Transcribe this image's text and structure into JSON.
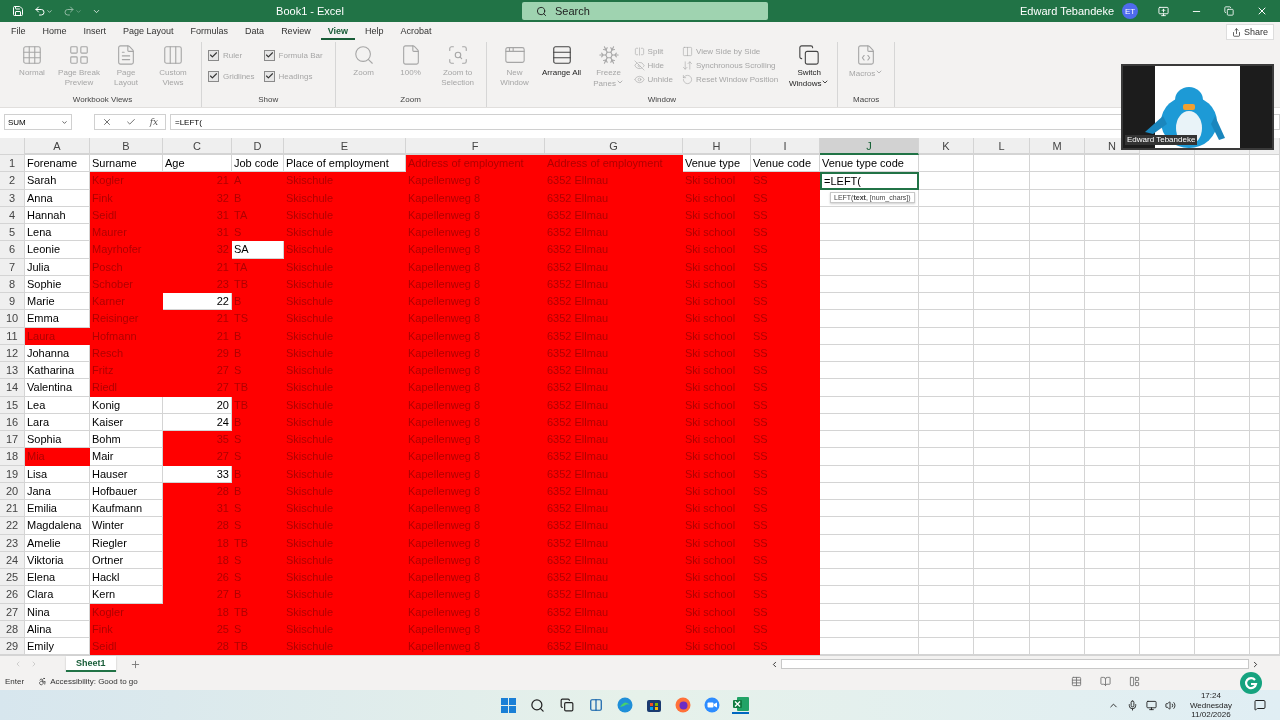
{
  "title_bar": {
    "title": "Book1  -  Excel",
    "search": {
      "placeholder": "Search"
    },
    "user": "Edward Tebandeke",
    "avatar": "ET"
  },
  "tabs": [
    {
      "label": "File",
      "selected": false
    },
    {
      "label": "Home",
      "selected": false
    },
    {
      "label": "Insert",
      "selected": false
    },
    {
      "label": "Page Layout",
      "selected": false
    },
    {
      "label": "Formulas",
      "selected": false
    },
    {
      "label": "Data",
      "selected": false
    },
    {
      "label": "Review",
      "selected": false
    },
    {
      "label": "View",
      "selected": true
    },
    {
      "label": "Help",
      "selected": false
    },
    {
      "label": "Acrobat",
      "selected": false
    }
  ],
  "share": "Share",
  "ribbon": {
    "groups": [
      {
        "label": "Workbook Views",
        "items": [
          {
            "kind": "large",
            "label": "Normal",
            "disabled": true
          },
          {
            "kind": "large",
            "label": "Page Break Preview",
            "disabled": true
          },
          {
            "kind": "large",
            "label": "Page Layout",
            "disabled": true
          },
          {
            "kind": "large",
            "label": "Custom Views",
            "disabled": true
          }
        ]
      },
      {
        "label": "Show",
        "items": [
          {
            "kind": "checkbox",
            "label": "Ruler",
            "checked": true,
            "disabled": true
          },
          {
            "kind": "checkbox",
            "label": "Gridlines",
            "checked": true,
            "disabled": true
          },
          {
            "kind": "checkbox",
            "label": "Formula Bar",
            "checked": true,
            "disabled": true
          },
          {
            "kind": "checkbox",
            "label": "Headings",
            "checked": true,
            "disabled": true
          }
        ]
      },
      {
        "label": "Zoom",
        "items": [
          {
            "kind": "large",
            "label": "Zoom",
            "disabled": true
          },
          {
            "kind": "large",
            "label": "100%",
            "disabled": true
          },
          {
            "kind": "large",
            "label": "Zoom to Selection",
            "disabled": true
          }
        ]
      },
      {
        "label": "Window",
        "items": [
          {
            "kind": "large",
            "label": "New Window",
            "disabled": true
          },
          {
            "kind": "large",
            "label": "Arrange All",
            "disabled": false
          },
          {
            "kind": "large",
            "label": "Freeze Panes",
            "disabled": true,
            "dropdown": true
          },
          {
            "kind": "small",
            "label": "Split",
            "disabled": true
          },
          {
            "kind": "small",
            "label": "Hide",
            "disabled": true
          },
          {
            "kind": "small",
            "label": "Unhide",
            "disabled": true
          },
          {
            "kind": "small",
            "label": "View Side by Side",
            "disabled": true
          },
          {
            "kind": "small",
            "label": "Synchronous Scrolling",
            "disabled": true
          },
          {
            "kind": "small",
            "label": "Reset Window Position",
            "disabled": true
          },
          {
            "kind": "large",
            "label": "Switch Windows",
            "disabled": false,
            "dropdown": true
          }
        ]
      },
      {
        "label": "Macros",
        "items": [
          {
            "kind": "large",
            "label": "Macros",
            "disabled": true,
            "dropdown": true
          }
        ]
      }
    ]
  },
  "formula_bar": {
    "name_box": "SUM",
    "function_button": "fx",
    "formula": "=LEFT("
  },
  "video_overlay": {
    "name": "Edward Tebandeke"
  },
  "sheet": {
    "columns": [
      {
        "label": "A",
        "selected": false
      },
      {
        "label": "B",
        "selected": false
      },
      {
        "label": "C",
        "selected": false
      },
      {
        "label": "D",
        "selected": false
      },
      {
        "label": "E",
        "selected": false
      },
      {
        "label": "F",
        "selected": false
      },
      {
        "label": "G",
        "selected": false
      },
      {
        "label": "H",
        "selected": false
      },
      {
        "label": "I",
        "selected": false
      },
      {
        "label": "J",
        "selected": true
      },
      {
        "label": "K",
        "selected": false
      },
      {
        "label": "L",
        "selected": false
      },
      {
        "label": "M",
        "selected": false
      },
      {
        "label": "N",
        "selected": false
      }
    ],
    "rows": [
      {
        "number": "1",
        "cells": [
          {
            "text": "Forename",
            "highlighted": false
          },
          {
            "text": "Surname",
            "highlighted": false
          },
          {
            "text": "Age",
            "highlighted": false
          },
          {
            "text": "Job code",
            "highlighted": false
          },
          {
            "text": "Place of employment",
            "highlighted": false
          },
          {
            "text": "Address of employment",
            "highlighted": true
          },
          {
            "text": "Address of employment",
            "highlighted": true
          },
          {
            "text": "Venue type",
            "highlighted": false
          },
          {
            "text": "Venue code",
            "highlighted": false
          },
          {
            "text": "Venue type code",
            "highlighted": false
          }
        ]
      },
      {
        "number": "2",
        "edit": {
          "text": "=LEFT(",
          "tooltip": "LEFT(**text**, [num_chars])"
        },
        "cells": [
          {
            "text": "Sarah",
            "highlighted": false
          },
          {
            "text": "Kogler",
            "highlighted": true
          },
          {
            "text": "21",
            "highlighted": true,
            "kind": "number"
          },
          {
            "text": "A",
            "highlighted": true
          },
          {
            "text": "Skischule",
            "highlighted": true
          },
          {
            "text": "Kapellenweg 8",
            "highlighted": true
          },
          {
            "text": "6352 Ellmau",
            "highlighted": true
          },
          {
            "text": "Ski school",
            "highlighted": true
          },
          {
            "text": "SS",
            "highlighted": true
          }
        ]
      },
      {
        "number": "3",
        "cells": [
          {
            "text": "Anna",
            "highlighted": false
          },
          {
            "text": "Fink",
            "highlighted": true
          },
          {
            "text": "32",
            "highlighted": true,
            "kind": "number"
          },
          {
            "text": "B",
            "highlighted": true
          },
          {
            "text": "Skischule",
            "highlighted": true
          },
          {
            "text": "Kapellenweg 8",
            "highlighted": true
          },
          {
            "text": "6352 Ellmau",
            "highlighted": true
          },
          {
            "text": "Ski school",
            "highlighted": true
          },
          {
            "text": "SS",
            "highlighted": true
          }
        ]
      },
      {
        "number": "4",
        "cells": [
          {
            "text": "Hannah",
            "highlighted": false
          },
          {
            "text": "Seidl",
            "highlighted": true
          },
          {
            "text": "31",
            "highlighted": true,
            "kind": "number"
          },
          {
            "text": "TA",
            "highlighted": true
          },
          {
            "text": "Skischule",
            "highlighted": true
          },
          {
            "text": "Kapellenweg 8",
            "highlighted": true
          },
          {
            "text": "6352 Ellmau",
            "highlighted": true
          },
          {
            "text": "Ski school",
            "highlighted": true
          },
          {
            "text": "SS",
            "highlighted": true
          }
        ]
      },
      {
        "number": "5",
        "cells": [
          {
            "text": "Lena",
            "highlighted": false
          },
          {
            "text": "Maurer",
            "highlighted": true
          },
          {
            "text": "31",
            "highlighted": true,
            "kind": "number"
          },
          {
            "text": "S",
            "highlighted": true
          },
          {
            "text": "Skischule",
            "highlighted": true
          },
          {
            "text": "Kapellenweg 8",
            "highlighted": true
          },
          {
            "text": "6352 Ellmau",
            "highlighted": true
          },
          {
            "text": "Ski school",
            "highlighted": true
          },
          {
            "text": "SS",
            "highlighted": true
          }
        ]
      },
      {
        "number": "6",
        "cells": [
          {
            "text": "Leonie",
            "highlighted": false
          },
          {
            "text": "Mayrhofer",
            "highlighted": true
          },
          {
            "text": "32",
            "highlighted": true,
            "kind": "number"
          },
          {
            "text": "SA",
            "highlighted": false
          },
          {
            "text": "Skischule",
            "highlighted": true
          },
          {
            "text": "Kapellenweg 8",
            "highlighted": true
          },
          {
            "text": "6352 Ellmau",
            "highlighted": true
          },
          {
            "text": "Ski school",
            "highlighted": true
          },
          {
            "text": "SS",
            "highlighted": true
          }
        ]
      },
      {
        "number": "7",
        "cells": [
          {
            "text": "Julia",
            "highlighted": false
          },
          {
            "text": "Posch",
            "highlighted": true
          },
          {
            "text": "21",
            "highlighted": true,
            "kind": "number"
          },
          {
            "text": "TA",
            "highlighted": true
          },
          {
            "text": "Skischule",
            "highlighted": true
          },
          {
            "text": "Kapellenweg 8",
            "highlighted": true
          },
          {
            "text": "6352 Ellmau",
            "highlighted": true
          },
          {
            "text": "Ski school",
            "highlighted": true
          },
          {
            "text": "SS",
            "highlighted": true
          }
        ]
      },
      {
        "number": "8",
        "cells": [
          {
            "text": "Sophie",
            "highlighted": false
          },
          {
            "text": "Schober",
            "highlighted": true
          },
          {
            "text": "23",
            "highlighted": true,
            "kind": "number"
          },
          {
            "text": "TB",
            "highlighted": true
          },
          {
            "text": "Skischule",
            "highlighted": true
          },
          {
            "text": "Kapellenweg 8",
            "highlighted": true
          },
          {
            "text": "6352 Ellmau",
            "highlighted": true
          },
          {
            "text": "Ski school",
            "highlighted": true
          },
          {
            "text": "SS",
            "highlighted": true
          }
        ]
      },
      {
        "number": "9",
        "cells": [
          {
            "text": "Marie",
            "highlighted": false
          },
          {
            "text": "Karner",
            "highlighted": true
          },
          {
            "text": "22",
            "highlighted": false,
            "kind": "number"
          },
          {
            "text": "B",
            "highlighted": true
          },
          {
            "text": "Skischule",
            "highlighted": true
          },
          {
            "text": "Kapellenweg 8",
            "highlighted": true
          },
          {
            "text": "6352 Ellmau",
            "highlighted": true
          },
          {
            "text": "Ski school",
            "highlighted": true
          },
          {
            "text": "SS",
            "highlighted": true
          }
        ]
      },
      {
        "number": "10",
        "cells": [
          {
            "text": "Emma",
            "highlighted": false
          },
          {
            "text": "Reisinger",
            "highlighted": true
          },
          {
            "text": "21",
            "highlighted": true,
            "kind": "number"
          },
          {
            "text": "TS",
            "highlighted": true
          },
          {
            "text": "Skischule",
            "highlighted": true
          },
          {
            "text": "Kapellenweg 8",
            "highlighted": true
          },
          {
            "text": "6352 Ellmau",
            "highlighted": true
          },
          {
            "text": "Ski school",
            "highlighted": true
          },
          {
            "text": "SS",
            "highlighted": true
          }
        ]
      },
      {
        "number": "11",
        "cells": [
          {
            "text": "Laura",
            "highlighted": true
          },
          {
            "text": "Hofmann",
            "highlighted": true
          },
          {
            "text": "21",
            "highlighted": true,
            "kind": "number"
          },
          {
            "text": "B",
            "highlighted": true
          },
          {
            "text": "Skischule",
            "highlighted": true
          },
          {
            "text": "Kapellenweg 8",
            "highlighted": true
          },
          {
            "text": "6352 Ellmau",
            "highlighted": true
          },
          {
            "text": "Ski school",
            "highlighted": true
          },
          {
            "text": "SS",
            "highlighted": true
          }
        ]
      },
      {
        "number": "12",
        "cells": [
          {
            "text": "Johanna",
            "highlighted": false
          },
          {
            "text": "Resch",
            "highlighted": true
          },
          {
            "text": "29",
            "highlighted": true,
            "kind": "number"
          },
          {
            "text": "B",
            "highlighted": true
          },
          {
            "text": "Skischule",
            "highlighted": true
          },
          {
            "text": "Kapellenweg 8",
            "highlighted": true
          },
          {
            "text": "6352 Ellmau",
            "highlighted": true
          },
          {
            "text": "Ski school",
            "highlighted": true
          },
          {
            "text": "SS",
            "highlighted": true
          }
        ]
      },
      {
        "number": "13",
        "cells": [
          {
            "text": "Katharina",
            "highlighted": false
          },
          {
            "text": "Fritz",
            "highlighted": true
          },
          {
            "text": "27",
            "highlighted": true,
            "kind": "number"
          },
          {
            "text": "S",
            "highlighted": true
          },
          {
            "text": "Skischule",
            "highlighted": true
          },
          {
            "text": "Kapellenweg 8",
            "highlighted": true
          },
          {
            "text": "6352 Ellmau",
            "highlighted": true
          },
          {
            "text": "Ski school",
            "highlighted": true
          },
          {
            "text": "SS",
            "highlighted": true
          }
        ]
      },
      {
        "number": "14",
        "cells": [
          {
            "text": "Valentina",
            "highlighted": false
          },
          {
            "text": "Riedl",
            "highlighted": true
          },
          {
            "text": "27",
            "highlighted": true,
            "kind": "number"
          },
          {
            "text": "TB",
            "highlighted": true
          },
          {
            "text": "Skischule",
            "highlighted": true
          },
          {
            "text": "Kapellenweg 8",
            "highlighted": true
          },
          {
            "text": "6352 Ellmau",
            "highlighted": true
          },
          {
            "text": "Ski school",
            "highlighted": true
          },
          {
            "text": "SS",
            "highlighted": true
          }
        ]
      },
      {
        "number": "15",
        "cells": [
          {
            "text": "Lea",
            "highlighted": false
          },
          {
            "text": "Konig",
            "highlighted": false
          },
          {
            "text": "20",
            "highlighted": false,
            "kind": "number"
          },
          {
            "text": "TB",
            "highlighted": true
          },
          {
            "text": "Skischule",
            "highlighted": true
          },
          {
            "text": "Kapellenweg 8",
            "highlighted": true
          },
          {
            "text": "6352 Ellmau",
            "highlighted": true
          },
          {
            "text": "Ski school",
            "highlighted": true
          },
          {
            "text": "SS",
            "highlighted": true
          }
        ]
      },
      {
        "number": "16",
        "cells": [
          {
            "text": "Lara",
            "highlighted": false
          },
          {
            "text": "Kaiser",
            "highlighted": false
          },
          {
            "text": "24",
            "highlighted": false,
            "kind": "number"
          },
          {
            "text": "B",
            "highlighted": true
          },
          {
            "text": "Skischule",
            "highlighted": true
          },
          {
            "text": "Kapellenweg 8",
            "highlighted": true
          },
          {
            "text": "6352 Ellmau",
            "highlighted": true
          },
          {
            "text": "Ski school",
            "highlighted": true
          },
          {
            "text": "SS",
            "highlighted": true
          }
        ]
      },
      {
        "number": "17",
        "cells": [
          {
            "text": "Sophia",
            "highlighted": false
          },
          {
            "text": "Bohm",
            "highlighted": false
          },
          {
            "text": "35",
            "highlighted": true,
            "kind": "number"
          },
          {
            "text": "S",
            "highlighted": true
          },
          {
            "text": "Skischule",
            "highlighted": true
          },
          {
            "text": "Kapellenweg 8",
            "highlighted": true
          },
          {
            "text": "6352 Ellmau",
            "highlighted": true
          },
          {
            "text": "Ski school",
            "highlighted": true
          },
          {
            "text": "SS",
            "highlighted": true
          }
        ]
      },
      {
        "number": "18",
        "cells": [
          {
            "text": "Mia",
            "highlighted": true
          },
          {
            "text": "Mair",
            "highlighted": false
          },
          {
            "text": "27",
            "highlighted": true,
            "kind": "number"
          },
          {
            "text": "S",
            "highlighted": true
          },
          {
            "text": "Skischule",
            "highlighted": true
          },
          {
            "text": "Kapellenweg 8",
            "highlighted": true
          },
          {
            "text": "6352 Ellmau",
            "highlighted": true
          },
          {
            "text": "Ski school",
            "highlighted": true
          },
          {
            "text": "SS",
            "highlighted": true
          }
        ]
      },
      {
        "number": "19",
        "cells": [
          {
            "text": "Lisa",
            "highlighted": false
          },
          {
            "text": "Hauser",
            "highlighted": false
          },
          {
            "text": "33",
            "highlighted": false,
            "kind": "number"
          },
          {
            "text": "B",
            "highlighted": true
          },
          {
            "text": "Skischule",
            "highlighted": true
          },
          {
            "text": "Kapellenweg 8",
            "highlighted": true
          },
          {
            "text": "6352 Ellmau",
            "highlighted": true
          },
          {
            "text": "Ski school",
            "highlighted": true
          },
          {
            "text": "SS",
            "highlighted": true
          }
        ]
      },
      {
        "number": "20",
        "cells": [
          {
            "text": "Jana",
            "highlighted": false
          },
          {
            "text": "Hofbauer",
            "highlighted": false
          },
          {
            "text": "28",
            "highlighted": true,
            "kind": "number"
          },
          {
            "text": "B",
            "highlighted": true
          },
          {
            "text": "Skischule",
            "highlighted": true
          },
          {
            "text": "Kapellenweg 8",
            "highlighted": true
          },
          {
            "text": "6352 Ellmau",
            "highlighted": true
          },
          {
            "text": "Ski school",
            "highlighted": true
          },
          {
            "text": "SS",
            "highlighted": true
          }
        ]
      },
      {
        "number": "21",
        "cells": [
          {
            "text": "Emilia",
            "highlighted": false
          },
          {
            "text": "Kaufmann",
            "highlighted": false
          },
          {
            "text": "31",
            "highlighted": true,
            "kind": "number"
          },
          {
            "text": "S",
            "highlighted": true
          },
          {
            "text": "Skischule",
            "highlighted": true
          },
          {
            "text": "Kapellenweg 8",
            "highlighted": true
          },
          {
            "text": "6352 Ellmau",
            "highlighted": true
          },
          {
            "text": "Ski school",
            "highlighted": true
          },
          {
            "text": "SS",
            "highlighted": true
          }
        ]
      },
      {
        "number": "22",
        "cells": [
          {
            "text": "Magdalena",
            "highlighted": false
          },
          {
            "text": "Winter",
            "highlighted": false
          },
          {
            "text": "28",
            "highlighted": true,
            "kind": "number"
          },
          {
            "text": "S",
            "highlighted": true
          },
          {
            "text": "Skischule",
            "highlighted": true
          },
          {
            "text": "Kapellenweg 8",
            "highlighted": true
          },
          {
            "text": "6352 Ellmau",
            "highlighted": true
          },
          {
            "text": "Ski school",
            "highlighted": true
          },
          {
            "text": "SS",
            "highlighted": true
          }
        ]
      },
      {
        "number": "23",
        "cells": [
          {
            "text": "Amelie",
            "highlighted": false
          },
          {
            "text": "Riegler",
            "highlighted": false
          },
          {
            "text": "18",
            "highlighted": true,
            "kind": "number"
          },
          {
            "text": "TB",
            "highlighted": true
          },
          {
            "text": "Skischule",
            "highlighted": true
          },
          {
            "text": "Kapellenweg 8",
            "highlighted": true
          },
          {
            "text": "6352 Ellmau",
            "highlighted": true
          },
          {
            "text": "Ski school",
            "highlighted": true
          },
          {
            "text": "SS",
            "highlighted": true
          }
        ]
      },
      {
        "number": "24",
        "cells": [
          {
            "text": "Viktoria",
            "highlighted": false
          },
          {
            "text": "Ortner",
            "highlighted": false
          },
          {
            "text": "18",
            "highlighted": true,
            "kind": "number"
          },
          {
            "text": "S",
            "highlighted": true
          },
          {
            "text": "Skischule",
            "highlighted": true
          },
          {
            "text": "Kapellenweg 8",
            "highlighted": true
          },
          {
            "text": "6352 Ellmau",
            "highlighted": true
          },
          {
            "text": "Ski school",
            "highlighted": true
          },
          {
            "text": "SS",
            "highlighted": true
          }
        ]
      },
      {
        "number": "25",
        "cells": [
          {
            "text": "Elena",
            "highlighted": false
          },
          {
            "text": "Hackl",
            "highlighted": false
          },
          {
            "text": "26",
            "highlighted": true,
            "kind": "number"
          },
          {
            "text": "S",
            "highlighted": true
          },
          {
            "text": "Skischule",
            "highlighted": true
          },
          {
            "text": "Kapellenweg 8",
            "highlighted": true
          },
          {
            "text": "6352 Ellmau",
            "highlighted": true
          },
          {
            "text": "Ski school",
            "highlighted": true
          },
          {
            "text": "SS",
            "highlighted": true
          }
        ]
      },
      {
        "number": "26",
        "cells": [
          {
            "text": "Clara",
            "highlighted": false
          },
          {
            "text": "Kern",
            "highlighted": false
          },
          {
            "text": "27",
            "highlighted": true,
            "kind": "number"
          },
          {
            "text": "B",
            "highlighted": true
          },
          {
            "text": "Skischule",
            "highlighted": true
          },
          {
            "text": "Kapellenweg 8",
            "highlighted": true
          },
          {
            "text": "6352 Ellmau",
            "highlighted": true
          },
          {
            "text": "Ski school",
            "highlighted": true
          },
          {
            "text": "SS",
            "highlighted": true
          }
        ]
      },
      {
        "number": "27",
        "cells": [
          {
            "text": "Nina",
            "highlighted": false
          },
          {
            "text": "Kogler",
            "highlighted": true
          },
          {
            "text": "18",
            "highlighted": true,
            "kind": "number"
          },
          {
            "text": "TB",
            "highlighted": true
          },
          {
            "text": "Skischule",
            "highlighted": true
          },
          {
            "text": "Kapellenweg 8",
            "highlighted": true
          },
          {
            "text": "6352 Ellmau",
            "highlighted": true
          },
          {
            "text": "Ski school",
            "highlighted": true
          },
          {
            "text": "SS",
            "highlighted": true
          }
        ]
      },
      {
        "number": "28",
        "cells": [
          {
            "text": "Alina",
            "highlighted": false
          },
          {
            "text": "Fink",
            "highlighted": true
          },
          {
            "text": "25",
            "highlighted": true,
            "kind": "number"
          },
          {
            "text": "S",
            "highlighted": true
          },
          {
            "text": "Skischule",
            "highlighted": true
          },
          {
            "text": "Kapellenweg 8",
            "highlighted": true
          },
          {
            "text": "6352 Ellmau",
            "highlighted": true
          },
          {
            "text": "Ski school",
            "highlighted": true
          },
          {
            "text": "SS",
            "highlighted": true
          }
        ]
      },
      {
        "number": "29",
        "cells": [
          {
            "text": "Emily",
            "highlighted": false
          },
          {
            "text": "Seidl",
            "highlighted": true
          },
          {
            "text": "28",
            "highlighted": true,
            "kind": "number"
          },
          {
            "text": "TB",
            "highlighted": true
          },
          {
            "text": "Skischule",
            "highlighted": true
          },
          {
            "text": "Kapellenweg 8",
            "highlighted": true
          },
          {
            "text": "6352 Ellmau",
            "highlighted": true
          },
          {
            "text": "Ski school",
            "highlighted": true
          },
          {
            "text": "SS",
            "highlighted": true
          }
        ]
      }
    ]
  },
  "sheet_tabs": [
    {
      "label": "Sheet1",
      "selected": true
    }
  ],
  "status_bar": {
    "mode": "Enter",
    "accessibility": "Accessibility: Good to go"
  },
  "taskbar": {
    "time": "17:24",
    "day": "Wednesday",
    "date": "11/02/2026"
  }
}
